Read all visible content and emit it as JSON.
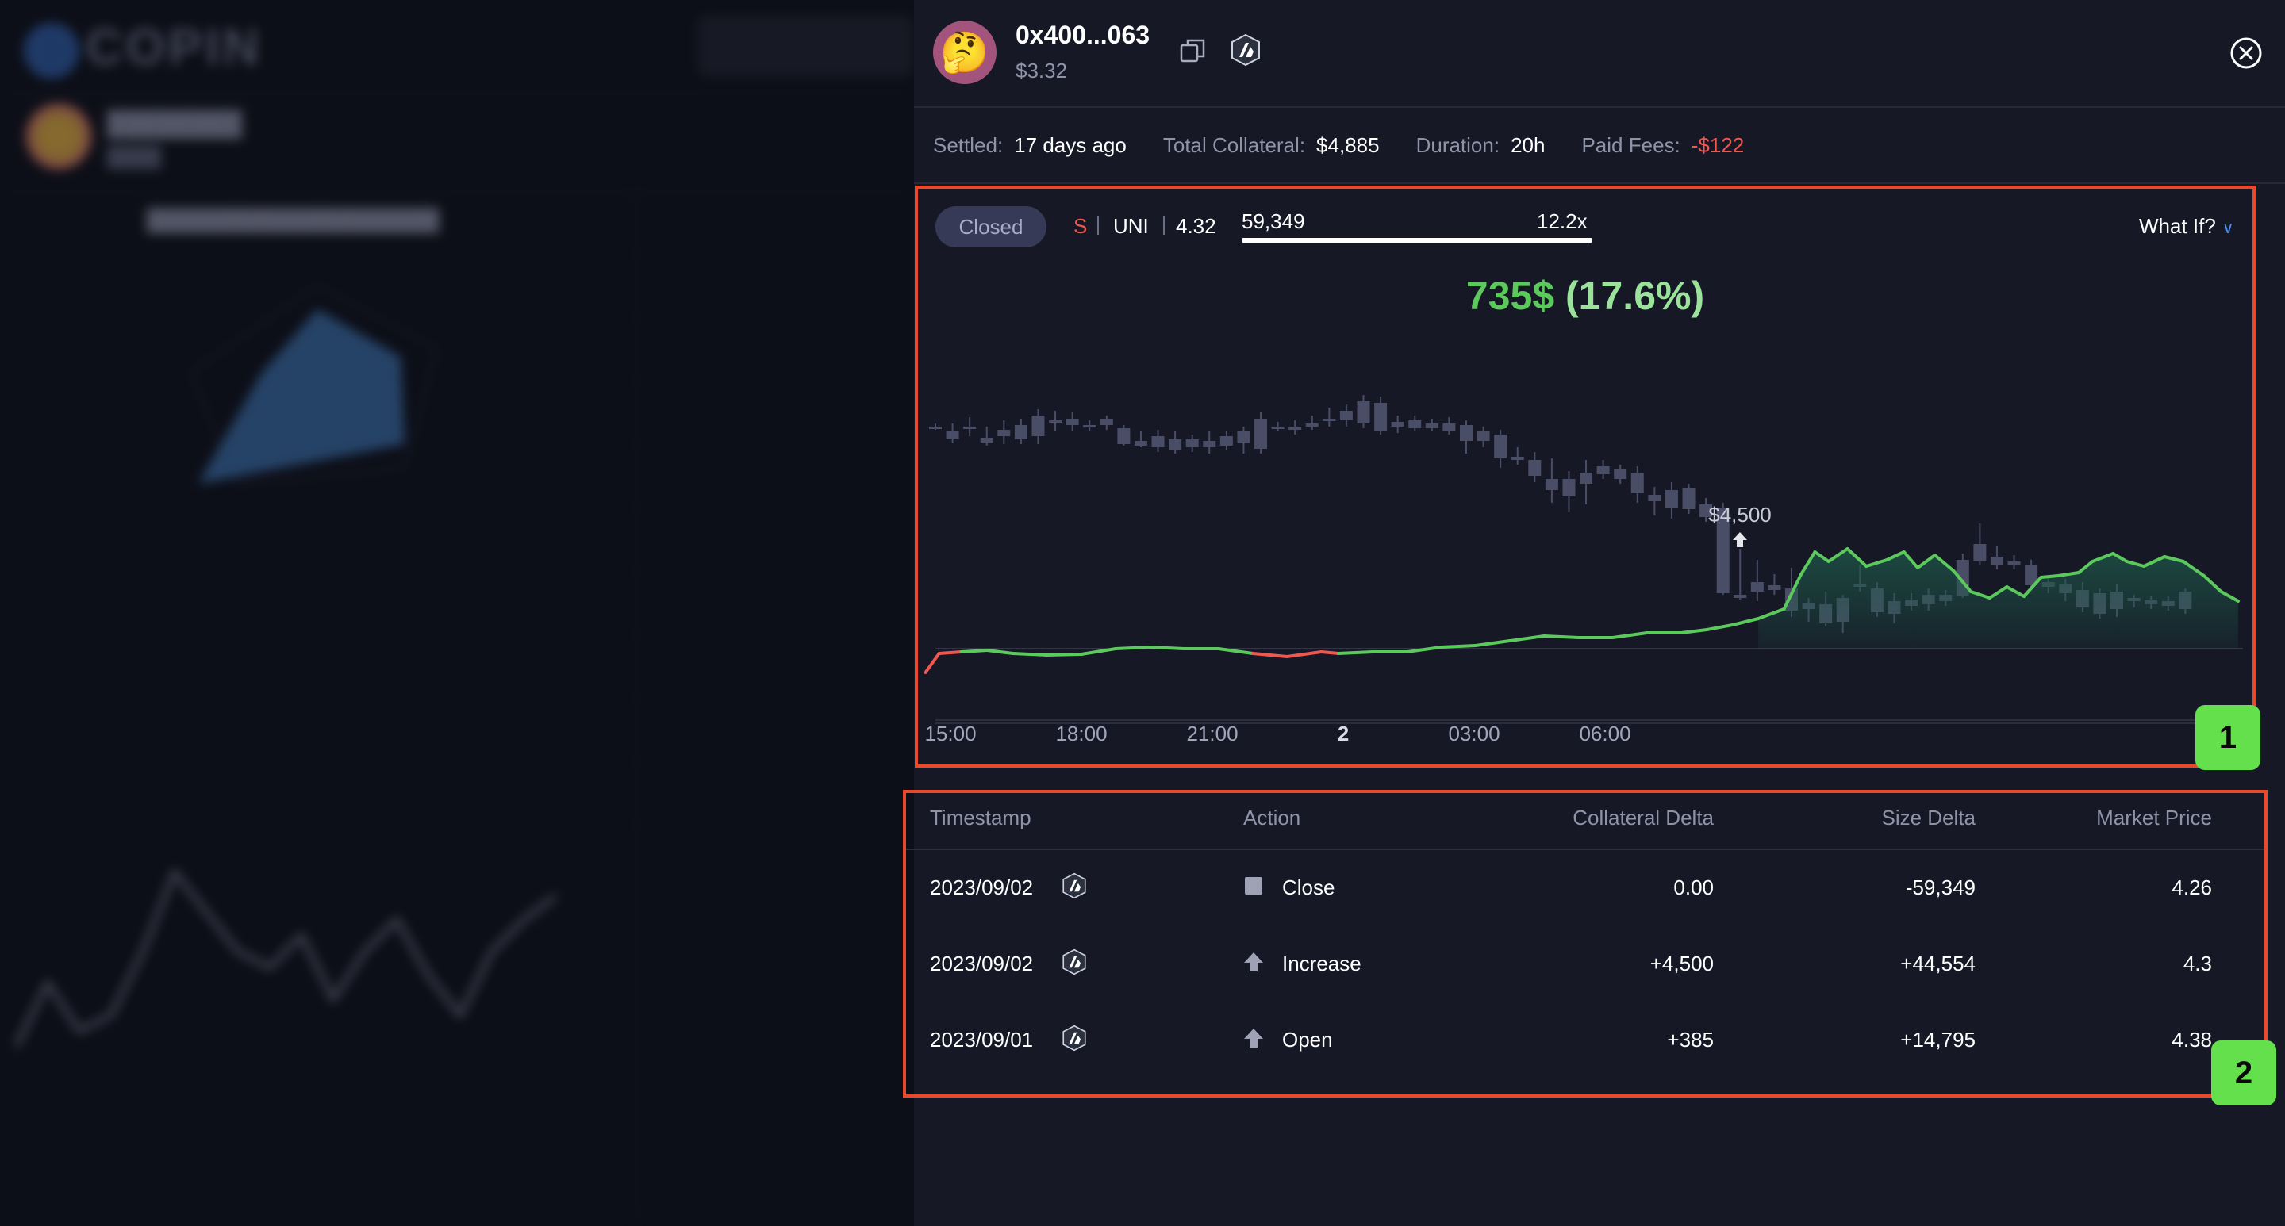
{
  "background": {
    "logo": "COPIN"
  },
  "header": {
    "address": "0x400...063",
    "balance": "$3.32",
    "avatar_emoji": "🤔"
  },
  "stats": [
    {
      "key": "Settled:",
      "value": "17 days ago"
    },
    {
      "key": "Total Collateral:",
      "value": "$4,885"
    },
    {
      "key": "Duration:",
      "value": "20h"
    },
    {
      "key": "Paid Fees:",
      "value": "-$122"
    }
  ],
  "position": {
    "status": "Closed",
    "side": "S",
    "token": "UNI",
    "entry_price": "4.32",
    "size": "59,349",
    "leverage": "12.2x",
    "what_if_label": "What If?",
    "pnl_value": "735$",
    "pnl_percent": "(17.6%)",
    "marker_label": "$4,500"
  },
  "chart": {
    "x_ticks": [
      "15:00",
      "18:00",
      "21:00",
      "2",
      "03:00",
      "06:00"
    ],
    "colors": {
      "profit": "#5cc95c",
      "loss": "#f0584f",
      "candle": "#4a4d66"
    }
  },
  "badges": [
    "1",
    "2"
  ],
  "table": {
    "headers": [
      "Timestamp",
      "Action",
      "Collateral Delta",
      "Size Delta",
      "Market Price"
    ],
    "rows": [
      {
        "timestamp": "2023/09/02",
        "action": "Close",
        "icon": "stop-square-icon",
        "collateral_delta": "0.00",
        "size_delta": "-59,349",
        "market_price": "4.26"
      },
      {
        "timestamp": "2023/09/02",
        "action": "Increase",
        "icon": "arrow-up-icon",
        "collateral_delta": "+4,500",
        "size_delta": "+44,554",
        "market_price": "4.3"
      },
      {
        "timestamp": "2023/09/01",
        "action": "Open",
        "icon": "arrow-up-icon",
        "collateral_delta": "+385",
        "size_delta": "+14,795",
        "market_price": "4.38"
      }
    ]
  }
}
